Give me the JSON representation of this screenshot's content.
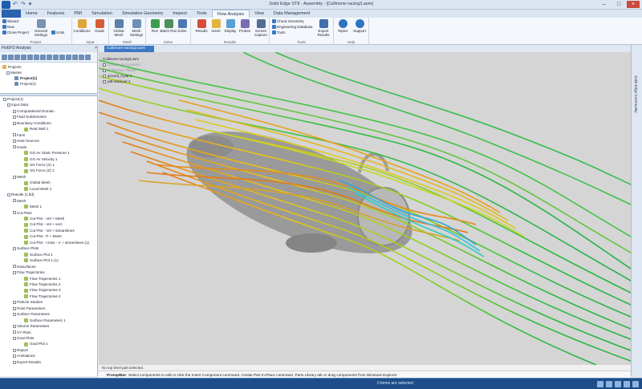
{
  "window": {
    "title": "Solid Edge ST8 - Assembly - [Cullimore-racing3.asm]",
    "qat": [
      "↶",
      "↷",
      "▾"
    ]
  },
  "tabs": [
    "Home",
    "Features",
    "PMI",
    "Simulation",
    "Simulation Geometry",
    "Inspect",
    "Tools",
    "Flow Analysis",
    "View",
    "Data Management"
  ],
  "ribbon": {
    "project_small": [
      "Wizard",
      "New",
      "Clone Project"
    ],
    "general_settings": "General Settings",
    "units": "Units",
    "conditions": "Conditions",
    "goals": "Goals",
    "global_mesh": "Global Mesh",
    "mesh_settings": "Mesh Settings",
    "run": "Run",
    "batch_run": "Batch Run",
    "solve": "Solve",
    "results": "Results",
    "insert": "Insert",
    "display": "Display",
    "probes": "Probes",
    "screen_capture": "Screen Capture",
    "tools_small": [
      "Check Geometry",
      "Engineering Database",
      "Tools"
    ],
    "export_results": "Export Results",
    "topics": "Topics",
    "support": "Support",
    "groups": [
      "Project",
      "Input",
      "Mesh",
      "Solve",
      "Results",
      "Tools",
      "Help"
    ]
  },
  "document_tab": "Cullimore-racing3.asm",
  "left_panel": {
    "title": "FloEFD Analysis",
    "top_tree": [
      "Projects",
      "Master",
      "Project(1)",
      "Project(2)"
    ],
    "tree": [
      {
        "t": "Project(1)",
        "lv": 0
      },
      {
        "t": "Input Data",
        "lv": 1
      },
      {
        "t": "Computational Domain",
        "lv": 2
      },
      {
        "t": "Fluid Subdomains",
        "lv": 2
      },
      {
        "t": "Boundary Conditions",
        "lv": 2
      },
      {
        "t": "Real Wall 1",
        "lv": 3
      },
      {
        "t": "Fans",
        "lv": 2
      },
      {
        "t": "Heat Sources",
        "lv": 2
      },
      {
        "t": "Goals",
        "lv": 2
      },
      {
        "t": "GG Av Static Pressure 1",
        "lv": 3
      },
      {
        "t": "GG Av Velocity 1",
        "lv": 3
      },
      {
        "t": "SG Force (X) 1",
        "lv": 3
      },
      {
        "t": "SG Force (Z) 1",
        "lv": 3
      },
      {
        "t": "Mesh",
        "lv": 2
      },
      {
        "t": "Global Mesh",
        "lv": 3
      },
      {
        "t": "Local Mesh 1",
        "lv": 3
      },
      {
        "t": "Results (1.fld)",
        "lv": 1
      },
      {
        "t": "Mesh",
        "lv": 2
      },
      {
        "t": "Mesh 1",
        "lv": 3
      },
      {
        "t": "Cut Plots",
        "lv": 2
      },
      {
        "t": "Cut Plot - Vel + Mesh",
        "lv": 3
      },
      {
        "t": "Cut Plot - Vel + vect",
        "lv": 3
      },
      {
        "t": "Cut Plot - Vel + streamlines",
        "lv": 3
      },
      {
        "t": "Cut Plot - P + Mesh",
        "lv": 3
      },
      {
        "t": "Cut Plot - cross - V + streamlines (1)",
        "lv": 3
      },
      {
        "t": "Surface Plots",
        "lv": 2
      },
      {
        "t": "Surface Plot 1",
        "lv": 3
      },
      {
        "t": "Surface Plot 1 (1)",
        "lv": 3
      },
      {
        "t": "Isosurfaces",
        "lv": 2
      },
      {
        "t": "Flow Trajectories",
        "lv": 2
      },
      {
        "t": "Flow Trajectories 1",
        "lv": 3
      },
      {
        "t": "Flow Trajectories 2",
        "lv": 3
      },
      {
        "t": "Flow Trajectories 3",
        "lv": 3
      },
      {
        "t": "Flow Trajectories 4",
        "lv": 3
      },
      {
        "t": "Particle Studies",
        "lv": 2
      },
      {
        "t": "Point Parameters",
        "lv": 2
      },
      {
        "t": "Surface Parameters",
        "lv": 2
      },
      {
        "t": "Surface Parameters 1",
        "lv": 3
      },
      {
        "t": "Volume Parameters",
        "lv": 2
      },
      {
        "t": "XY Plots",
        "lv": 2
      },
      {
        "t": "Goal Plots",
        "lv": 2
      },
      {
        "t": "Goal Plot 1",
        "lv": 3
      },
      {
        "t": "Report",
        "lv": 2
      },
      {
        "t": "Animations",
        "lv": 2
      },
      {
        "t": "Export Results",
        "lv": 2
      }
    ]
  },
  "viewport_tree": [
    "Cullimore-racing3.asm",
    "Coordinate Systems",
    "Reference Planes",
    "ground_0.par:1",
    "pt8-solid.par:1"
  ],
  "right_strip": "Solid Edge Community",
  "status_line": "No top level part selected.",
  "prompt": "Select components to edit or click the Insert Component command. Create Part In-Place command, Parts Library tab or drag components from Windows Explorer.",
  "prompt_label": "PromptBar",
  "status_bar": "0 items are selected",
  "colors": {
    "accent": "#2b62ad",
    "viewport": "#d5d5d5"
  }
}
